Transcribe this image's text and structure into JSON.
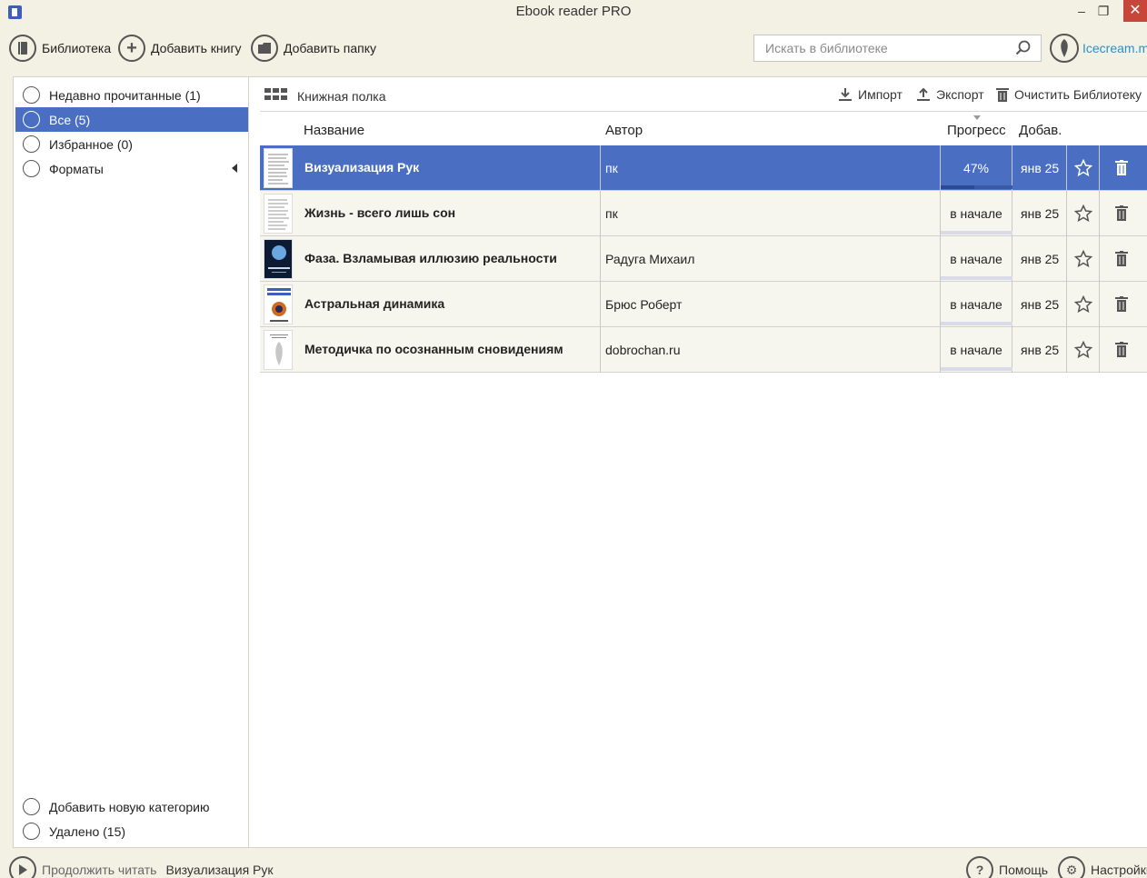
{
  "window": {
    "title": "Ebook reader PRO",
    "minimize": "‒",
    "restore": "❐",
    "close": "✕"
  },
  "toolbar": {
    "library_label": "Библиотека",
    "add_book_label": "Добавить книгу",
    "add_folder_label": "Добавить папку",
    "search_placeholder": "Искать в библиотеке",
    "brand_link": "Icecream.me"
  },
  "sidebar": {
    "items": [
      {
        "label": "Недавно прочитанные (1)",
        "icon": "recent-icon"
      },
      {
        "label": "Все (5)",
        "icon": "book-icon",
        "selected": true
      },
      {
        "label": "Избранное (0)",
        "icon": "star-icon"
      },
      {
        "label": "Форматы",
        "icon": "formats-icon",
        "has_submenu": true
      }
    ],
    "add_category": "Добавить новую категорию",
    "deleted": "Удалено (15)"
  },
  "main": {
    "view_label": "Книжная полка",
    "import_label": "Импорт",
    "export_label": "Экспорт",
    "clear_label": "Очистить Библиотеку",
    "columns": {
      "title": "Название",
      "author": "Автор",
      "progress": "Прогресс",
      "added": "Добав."
    },
    "books": [
      {
        "title": "Визуализация Рук",
        "author": "пк",
        "progress_text": "47%",
        "progress": 0.47,
        "added": "янв 25",
        "selected": true
      },
      {
        "title": "Жизнь - всего лишь сон",
        "author": "пк",
        "progress_text": "в начале",
        "progress": 0,
        "added": "янв 25"
      },
      {
        "title": "Фаза. Взламывая иллюзию реальности",
        "author": "Радуга Михаил",
        "progress_text": "в начале",
        "progress": 0,
        "added": "янв 25"
      },
      {
        "title": "Астральная динамика",
        "author": "Брюс Роберт",
        "progress_text": "в начале",
        "progress": 0,
        "added": "янв 25"
      },
      {
        "title": "Методичка по осознанным сновидениям",
        "author": "dobrochan.ru",
        "progress_text": "в начале",
        "progress": 0,
        "added": "янв 25"
      }
    ]
  },
  "bottom": {
    "continue_label": "Продолжить читать",
    "current_book": "Визуализация Рук",
    "help_label": "Помощь",
    "settings_label": "Настройки"
  },
  "colors": {
    "accent": "#4a6fc2",
    "background": "#f3f1e4",
    "close": "#c6463a",
    "link": "#2a8fc9"
  }
}
